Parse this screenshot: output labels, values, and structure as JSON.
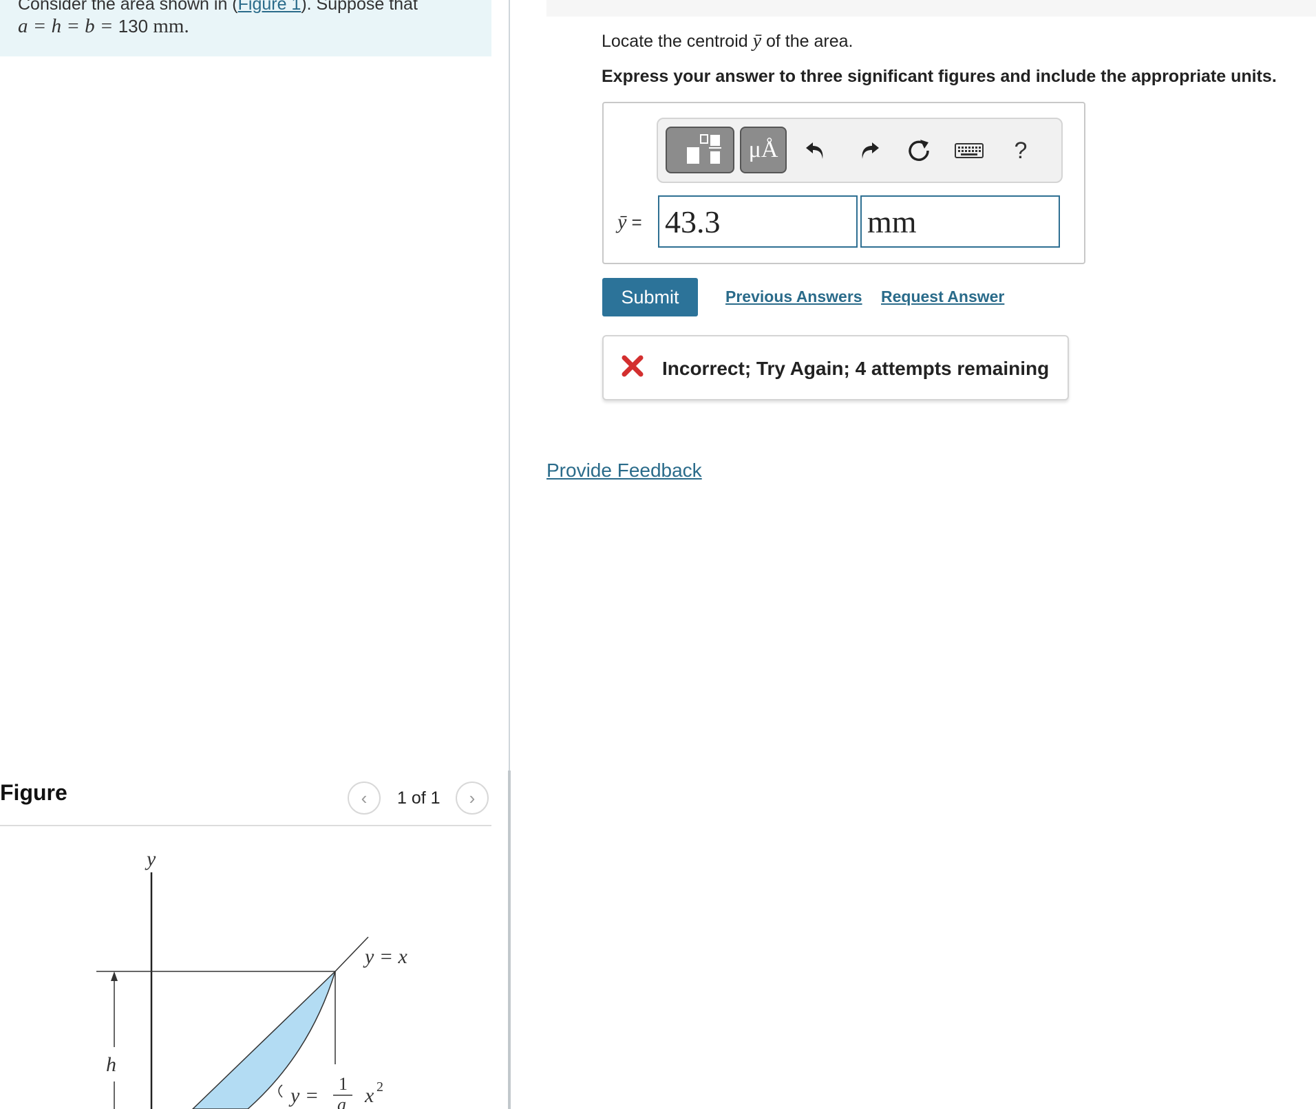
{
  "problem": {
    "prefix": "Consider the area shown in (",
    "figure_link": "Figure 1",
    "suffix": "). Suppose that",
    "eq_vars": "a = h = b =",
    "eq_value": "130",
    "eq_unit": "mm."
  },
  "figure": {
    "heading": "Figure",
    "counter": "1 of 1",
    "prev_icon": "chevron-left-icon",
    "next_icon": "chevron-right-icon",
    "label_y_axis": "y",
    "label_line": "y = x",
    "label_h": "h",
    "label_curve_lhs": "y =",
    "label_curve_num": "1",
    "label_curve_den": "a",
    "label_curve_rhs": "x",
    "label_curve_exp": "2",
    "shaded_color": "#b3dcf3"
  },
  "question": {
    "text_before": "Locate the centroid ",
    "symbol": "ȳ",
    "text_after": " of the area.",
    "instruction": "Express your answer to three significant figures and include the appropriate units."
  },
  "toolbar": {
    "templates_icon": "templates-icon",
    "units_label": "μÅ",
    "undo_icon": "undo-icon",
    "redo_icon": "redo-icon",
    "reset_icon": "reset-icon",
    "keyboard_icon": "keyboard-icon",
    "help_label": "?"
  },
  "answer": {
    "label_symbol": "ȳ",
    "label_eq": " =",
    "value": "43.3",
    "unit": "mm"
  },
  "actions": {
    "submit_label": "Submit",
    "previous_answers_label": "Previous Answers",
    "request_answer_label": "Request Answer"
  },
  "feedback": {
    "status_icon": "incorrect-x-icon",
    "status_color": "#d32f2f",
    "message": "Incorrect; Try Again; 4 attempts remaining"
  },
  "footer": {
    "provide_feedback_label": "Provide Feedback"
  },
  "colors": {
    "link": "#2a6b8a",
    "submit_bg": "#2c7399",
    "problem_bg": "#e9f5f8",
    "input_border": "#2e6f92"
  }
}
